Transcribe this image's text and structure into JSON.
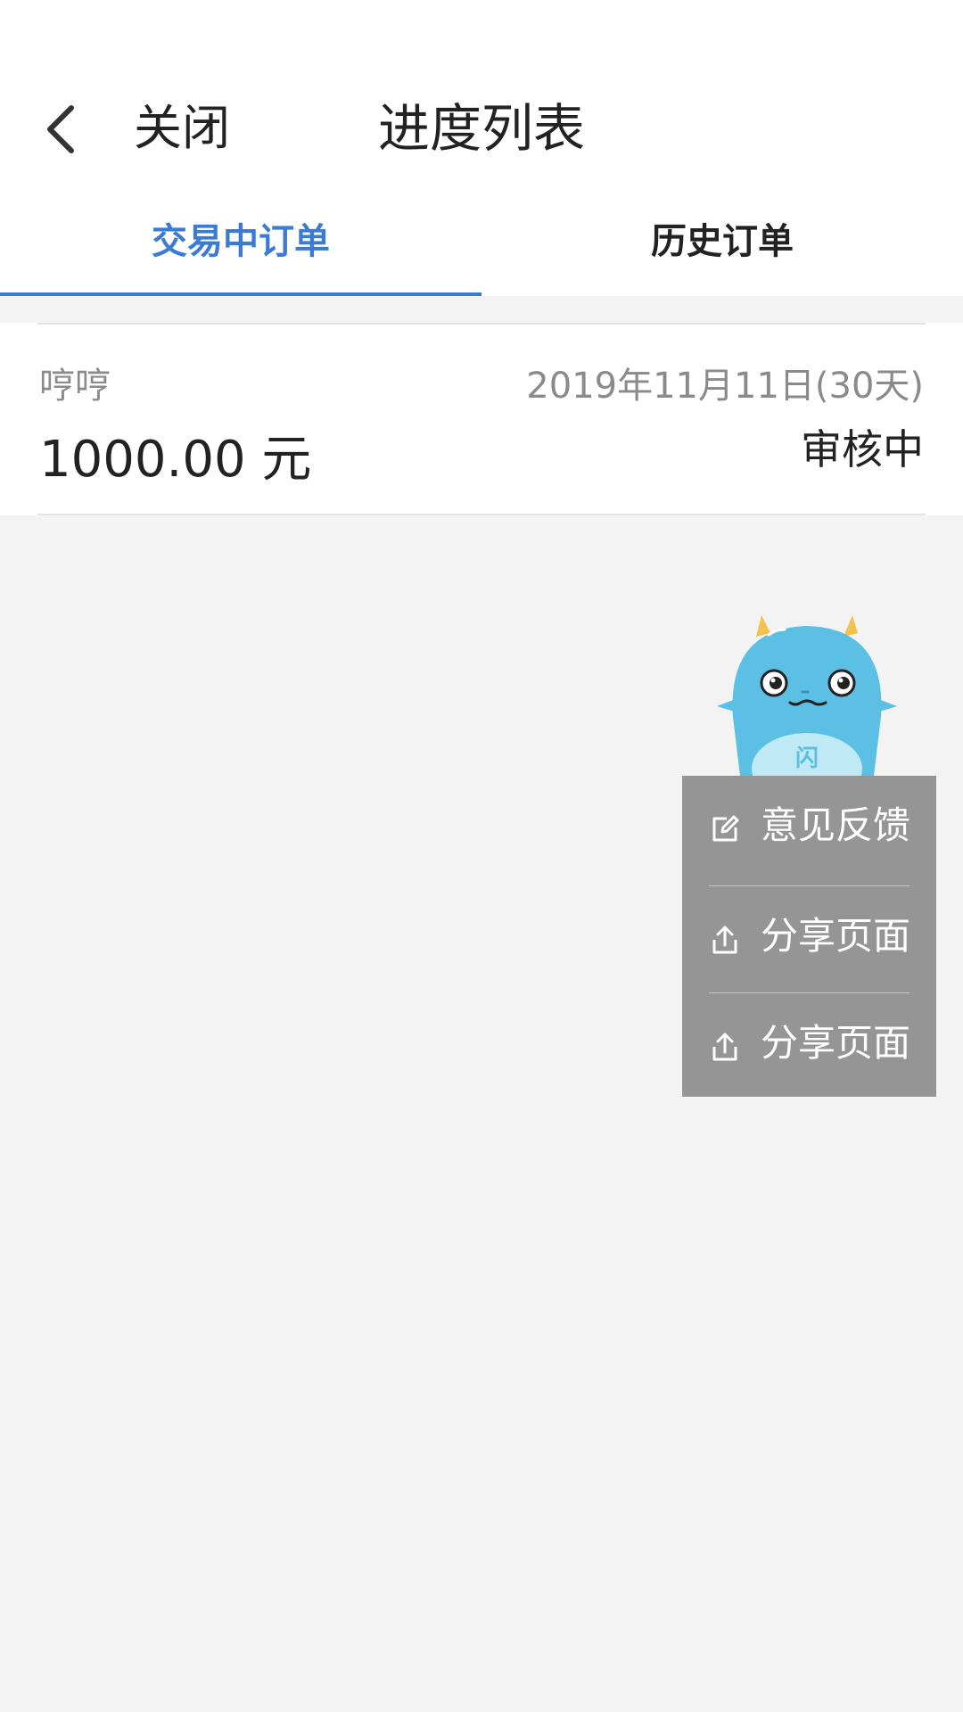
{
  "header": {
    "close_label": "关闭",
    "title": "进度列表",
    "back_icon": "chevron-left-icon"
  },
  "tabs": [
    {
      "label": "交易中订单",
      "active": true
    },
    {
      "label": "历史订单",
      "active": false
    }
  ],
  "orders": [
    {
      "name": "哼哼",
      "date": "2019年11月11日(30天)",
      "amount": "1000.00 元",
      "status": "审核中"
    }
  ],
  "mascot": {
    "badge_text": "闪",
    "icon": "mascot-icon"
  },
  "menu": {
    "items": [
      {
        "label": "意见反馈",
        "icon": "edit-icon"
      },
      {
        "label": "分享页面",
        "icon": "share-icon"
      },
      {
        "label": "分享页面",
        "icon": "share-icon"
      }
    ]
  },
  "colors": {
    "accent": "#3b7bd4",
    "background": "#f3f3f3",
    "menu_bg": "#959595",
    "mascot_blue": "#5cc0e4",
    "mascot_horn": "#f2c14e"
  }
}
